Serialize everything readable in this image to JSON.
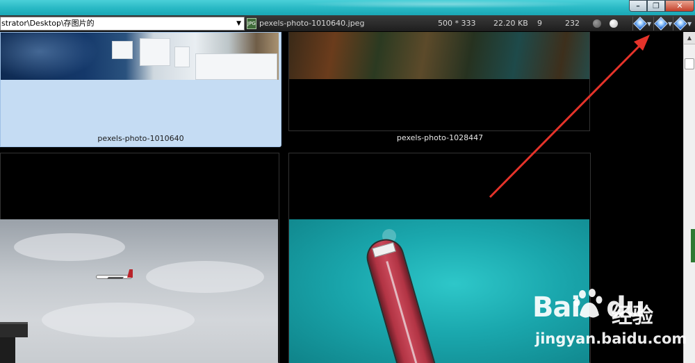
{
  "window": {
    "controls": {
      "minimize_icon": "minimize-icon",
      "maximize_icon": "restore-icon",
      "close_icon": "close-icon"
    },
    "titlebar_color": "#28b8c4"
  },
  "toolbar": {
    "path": "strator\\Desktop\\存图片的",
    "file_name": "pexels-photo-1010640.jpeg",
    "file_icon_text": "JPG",
    "dimensions": "500 * 333",
    "file_size": "22.20 KB",
    "count_a": "9",
    "count_b": "232",
    "nav_buttons": [
      "nav-prev-icon",
      "nav-next-icon",
      "nav-menu-icon"
    ]
  },
  "thumbnails": [
    {
      "caption": "pexels-photo-1010640",
      "selected": true
    },
    {
      "caption": "pexels-photo-1028447",
      "selected": false
    },
    {
      "caption": "",
      "selected": false
    },
    {
      "caption": "",
      "selected": false
    }
  ],
  "watermark": {
    "logo": "Bai",
    "logo_suffix": "du",
    "chinese": "经验",
    "url": "jingyan.baidu.com"
  },
  "colors": {
    "selection": "#c5dcf3",
    "annotation_arrow": "#e5332a",
    "toolbar": "#2a2a2a"
  }
}
